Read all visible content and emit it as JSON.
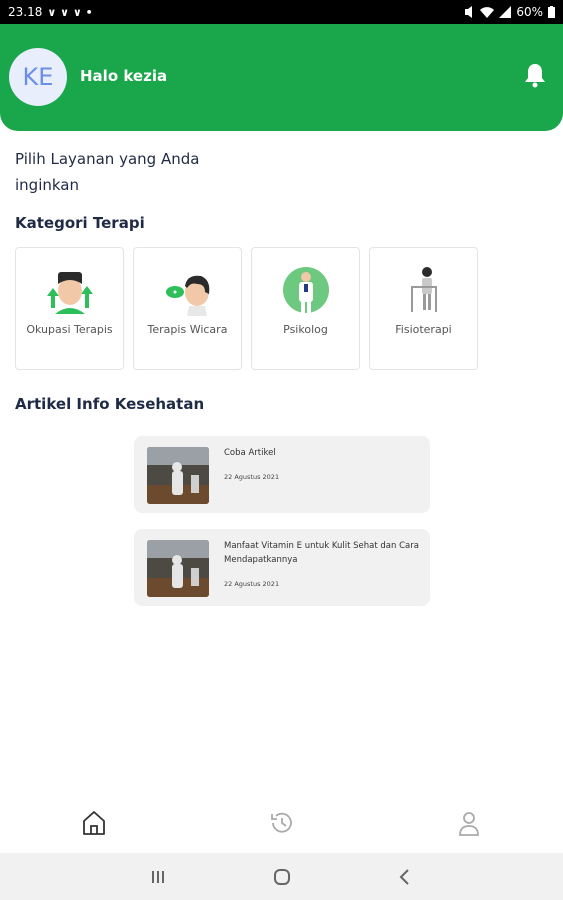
{
  "status_bar": {
    "time": "23.18",
    "notif_icons": "∨ ∨ ∨ •",
    "battery": "60%"
  },
  "header": {
    "avatar_initials": "KE",
    "greeting": "Halo kezia"
  },
  "prompt": "Pilih Layanan yang Anda inginkan",
  "categories": {
    "title": "Kategori Terapi",
    "items": [
      {
        "label": "Okupasi Terapis",
        "icon": "occupational-therapy-icon"
      },
      {
        "label": "Terapis Wicara",
        "icon": "speech-therapy-icon"
      },
      {
        "label": "Psikolog",
        "icon": "psychologist-icon"
      },
      {
        "label": "Fisioterapi",
        "icon": "physiotherapy-icon"
      }
    ]
  },
  "articles": {
    "title": "Artikel Info Kesehatan",
    "items": [
      {
        "title": "Coba Artikel",
        "date": "22 Agustus 2021"
      },
      {
        "title": "Manfaat Vitamin E untuk Kulit Sehat dan Cara Mendapatkannya",
        "date": "22 Agustus 2021"
      }
    ]
  },
  "bottom_nav": [
    "home-icon",
    "history-icon",
    "profile-icon"
  ],
  "colors": {
    "primary": "#1aa64a",
    "text": "#1f2a44",
    "card_border": "#e4e4e4",
    "article_bg": "#f1f1f1"
  }
}
